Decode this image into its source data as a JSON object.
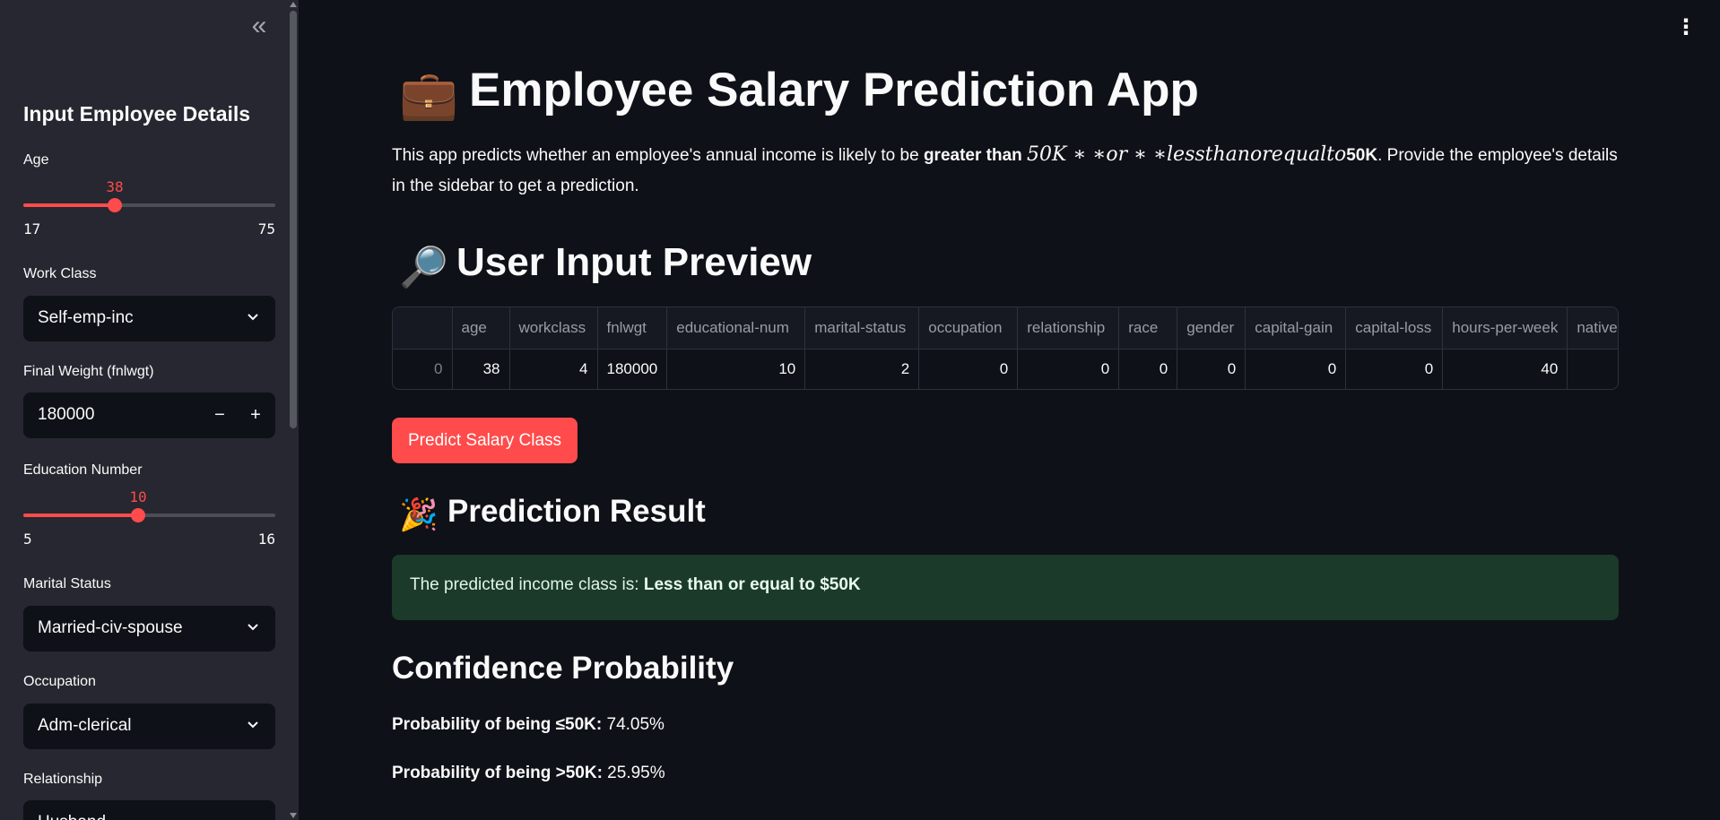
{
  "sidebar": {
    "collapse_glyph": "«",
    "title": "Input Employee Details",
    "age": {
      "label": "Age",
      "value": "38",
      "min": "17",
      "max": "75",
      "fraction": 0.362
    },
    "workclass": {
      "label": "Work Class",
      "value": "Self-emp-inc"
    },
    "fnlwgt": {
      "label": "Final Weight (fnlwgt)",
      "value": "180000",
      "minus": "−",
      "plus": "+"
    },
    "education": {
      "label": "Education Number",
      "value": "10",
      "min": "5",
      "max": "16",
      "fraction": 0.455
    },
    "marital": {
      "label": "Marital Status",
      "value": "Married-civ-spouse"
    },
    "occupation": {
      "label": "Occupation",
      "value": "Adm-clerical"
    },
    "relationship": {
      "label": "Relationship",
      "value": "Husband"
    }
  },
  "menu_glyph": "⋮",
  "main": {
    "title_emoji": "💼",
    "title": "Employee Salary Prediction App",
    "intro": {
      "part1": "This app predicts whether an employee's annual income is likely to be ",
      "bold1": "greater than ",
      "math": "50K ∗ ∗or ∗ ∗lessthanorequalto",
      "bold2": "50K",
      "part2": ". Provide the employee's details in the sidebar to get a prediction."
    },
    "preview_emoji": "🔎",
    "preview_title": "User Input Preview",
    "table": {
      "columns": [
        "",
        "age",
        "workclass",
        "fnlwgt",
        "educational-num",
        "marital-status",
        "occupation",
        "relationship",
        "race",
        "gender",
        "capital-gain",
        "capital-loss",
        "hours-per-week",
        "native"
      ],
      "row": [
        "0",
        "38",
        "4",
        "180000",
        "10",
        "2",
        "0",
        "0",
        "0",
        "0",
        "0",
        "0",
        "40",
        ""
      ]
    },
    "predict_button": "Predict Salary Class",
    "result_emoji": "🎉",
    "result_title": "Prediction Result",
    "result_prefix": "The predicted income class is: ",
    "result_value": "Less than or equal to $50K",
    "confidence_title": "Confidence Probability",
    "prob_low_label": "Probability of being ≤50K:",
    "prob_low_value": " 74.05%",
    "prob_high_label": "Probability of being >50K:",
    "prob_high_value": " 25.95%"
  },
  "colors": {
    "accent": "#ff4b4b",
    "background": "#0e1117",
    "sidebar": "#262730",
    "success_bg": "#1b3a2a"
  }
}
